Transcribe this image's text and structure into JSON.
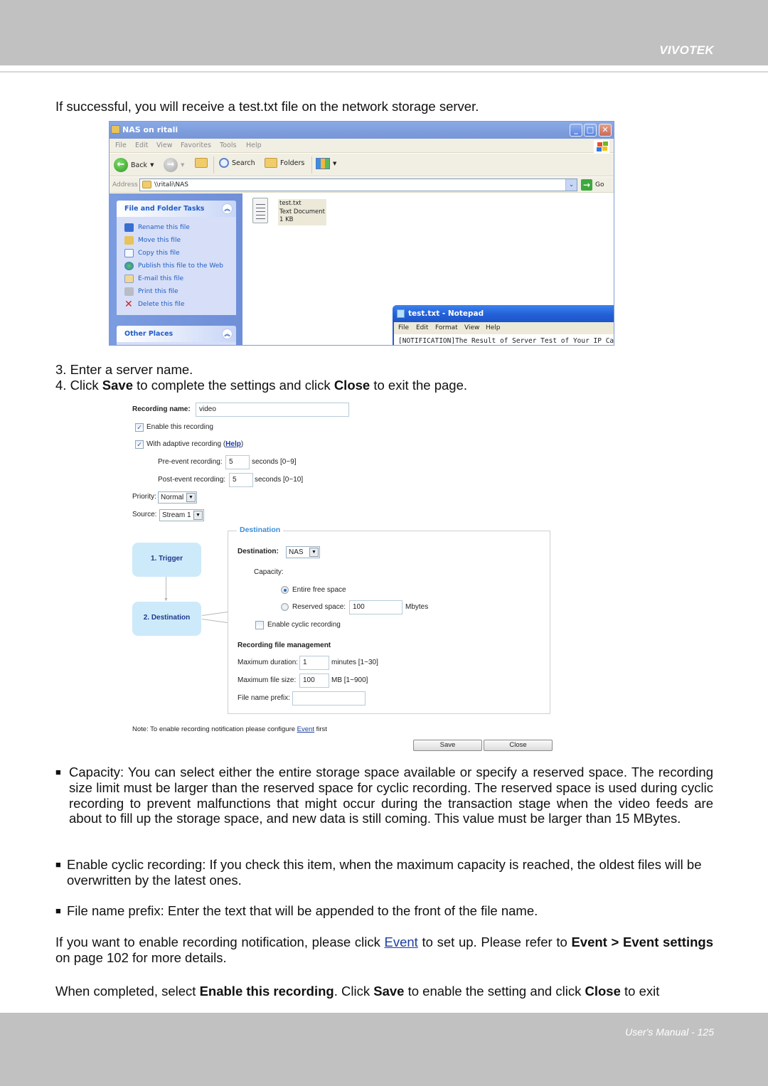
{
  "header": {
    "brand": "VIVOTEK"
  },
  "footer": {
    "page_label": "User's Manual - 125"
  },
  "intro": "If successful, you will receive a test.txt file on the network storage server.",
  "explorer": {
    "title": "NAS on ritali",
    "menu": [
      "File",
      "Edit",
      "View",
      "Favorites",
      "Tools",
      "Help"
    ],
    "toolbar": {
      "back": "Back",
      "search": "Search",
      "folders": "Folders"
    },
    "address_label": "Address",
    "address_value": "\\\\ritali\\NAS",
    "go_label": "Go",
    "tasks_panel": {
      "title": "File and Folder Tasks",
      "items": [
        {
          "label": "Rename this file",
          "icon": "rename-icon"
        },
        {
          "label": "Move this file",
          "icon": "move-icon"
        },
        {
          "label": "Copy this file",
          "icon": "copy-icon"
        },
        {
          "label": "Publish this file to the Web",
          "icon": "globe-icon"
        },
        {
          "label": "E-mail this file",
          "icon": "email-icon"
        },
        {
          "label": "Print this file",
          "icon": "printer-icon"
        },
        {
          "label": "Delete this file",
          "icon": "delete-icon"
        }
      ]
    },
    "other_places_title": "Other Places",
    "file": {
      "name": "test.txt",
      "type": "Text Document",
      "size": "1 KB"
    }
  },
  "notepad": {
    "title": "test.txt - Notepad",
    "menu": [
      "File",
      "Edit",
      "Format",
      "View",
      "Help"
    ],
    "content": "[NOTIFICATION]The Result of Server Test of Your IP Camera"
  },
  "steps": {
    "step3": "3. Enter a server name.",
    "step4_prefix": "4. Click ",
    "step4_save": "Save",
    "step4_mid": " to complete the settings and click ",
    "step4_close": "Close",
    "step4_suffix": " to exit the page."
  },
  "recording": {
    "name_label": "Recording name:",
    "name_value": "video",
    "enable_label": "Enable this recording",
    "enable_checked": true,
    "adaptive_label": "With adaptive recording (",
    "adaptive_help": "Help",
    "adaptive_close": ")",
    "adaptive_checked": true,
    "pre_event_label": "Pre-event recording:",
    "pre_event_value": "5",
    "pre_event_unit": "seconds [0~9]",
    "post_event_label": "Post-event recording:",
    "post_event_value": "5",
    "post_event_unit": "seconds [0~10]",
    "priority_label": "Priority:",
    "priority_value": "Normal",
    "source_label": "Source:",
    "source_value": "Stream 1",
    "flow": {
      "step1": "1.  Trigger",
      "step2": "2.  Destination"
    },
    "destination_legend": "Destination",
    "destination_label": "Destination:",
    "destination_value": "NAS",
    "capacity_label": "Capacity:",
    "capacity_options": [
      {
        "label": "Entire free space",
        "selected": true
      },
      {
        "label": "Reserved space:",
        "selected": false
      }
    ],
    "reserved_value": "100",
    "reserved_unit": "Mbytes",
    "cyclic_label": "Enable cyclic recording",
    "cyclic_checked": false,
    "file_mgmt_title": "Recording file management",
    "max_duration_label": "Maximum duration:",
    "max_duration_value": "1",
    "max_duration_unit": "minutes [1~30]",
    "max_size_label": "Maximum file size:",
    "max_size_value": "100",
    "max_size_unit": "MB [1~900]",
    "prefix_label": "File name prefix:",
    "prefix_value": "",
    "note_prefix": "Note: To enable recording notification please configure ",
    "note_link": "Event",
    "note_suffix": " first",
    "save_label": "Save",
    "close_label": "Close"
  },
  "bullets": [
    "Capacity: You can select either the entire storage space available or specify a reserved space. The recording size limit must be larger than the reserved space for cyclic recording. The reserved space is used during cyclic recording to prevent malfunctions that might occur during the transaction stage when the video feeds are about to fill up the storage space, and new data is still coming. This value must be larger than 15 MBytes.",
    "Enable cyclic recording: If you check this item, when the maximum capacity is reached, the oldest files will be overwritten by the latest ones.",
    "File name prefix: Enter the text that will be appended to the front of the file name."
  ],
  "notification_para": {
    "prefix": "If you want to enable recording notification, please click ",
    "link": "Event",
    "mid": " to set up. Please refer to ",
    "bold1": "Event > Event settings",
    "suffix": " on page 102 for more details."
  },
  "completed_para": {
    "p1": "When completed, select ",
    "b1": "Enable this recording",
    "p2": ". Click ",
    "b2": "Save",
    "p3": " to enable the setting and click ",
    "b3": "Close",
    "p4": " to exit"
  }
}
